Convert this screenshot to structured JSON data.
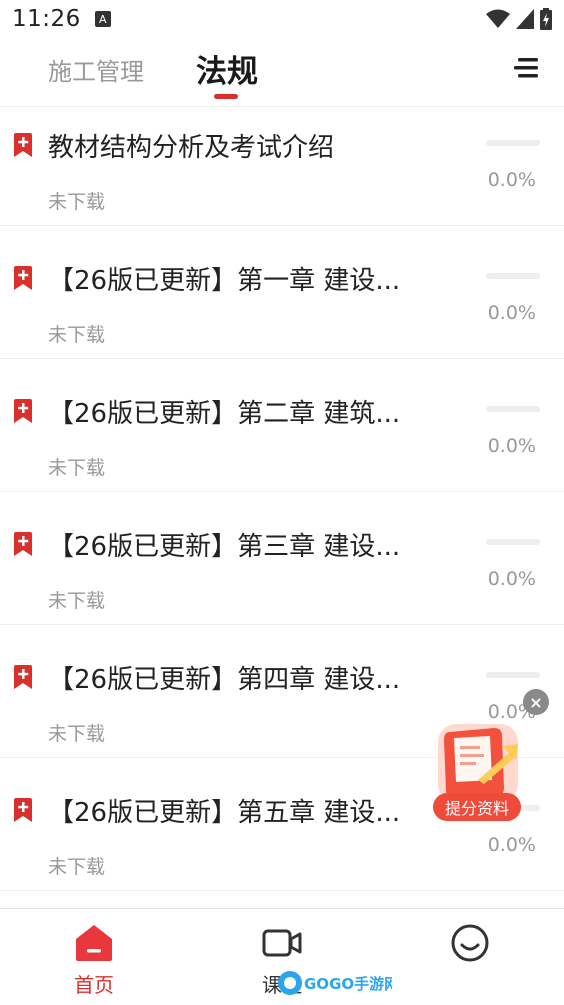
{
  "status_bar": {
    "time": "11:26",
    "notification_icon_letter": "A",
    "icons": [
      "notification-icon",
      "wifi-icon",
      "signal-icon",
      "battery-icon"
    ]
  },
  "tabs": [
    {
      "label": "施工管理",
      "active": false
    },
    {
      "label": "法规",
      "active": true
    }
  ],
  "accent_color": "#d9302c",
  "list": [
    {
      "title": "教材结构分析及考试介绍",
      "status": "未下载",
      "progress_text": "0.0%",
      "progress": 0
    },
    {
      "title": "【26版已更新】第一章 建设...",
      "status": "未下载",
      "progress_text": "0.0%",
      "progress": 0
    },
    {
      "title": "【26版已更新】第二章 建筑...",
      "status": "未下载",
      "progress_text": "0.0%",
      "progress": 0
    },
    {
      "title": "【26版已更新】第三章 建设...",
      "status": "未下载",
      "progress_text": "0.0%",
      "progress": 0
    },
    {
      "title": "【26版已更新】第四章 建设...",
      "status": "未下载",
      "progress_text": "0.0%",
      "progress": 0
    },
    {
      "title": "【26版已更新】第五章 建设...",
      "status": "未下载",
      "progress_text": "0.0%",
      "progress": 0
    }
  ],
  "promo": {
    "label": "提分资料",
    "close_symbol": "×"
  },
  "bottom_nav": [
    {
      "label": "首页",
      "icon": "home-icon",
      "active": true
    },
    {
      "label": "课程",
      "icon": "video-icon",
      "active": false
    },
    {
      "label": "",
      "icon": "smile-icon",
      "active": false
    }
  ],
  "watermark": {
    "text": "GOGO手游网"
  }
}
